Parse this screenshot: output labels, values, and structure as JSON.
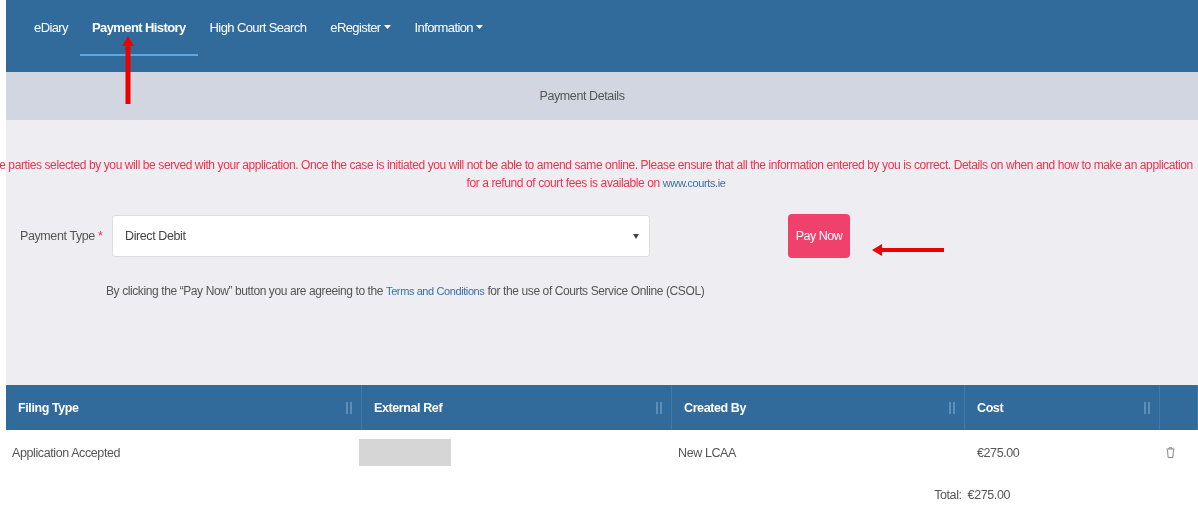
{
  "nav": {
    "items": [
      {
        "label": "eDiary",
        "selected": false,
        "dropdown": false
      },
      {
        "label": "Payment History",
        "selected": true,
        "dropdown": false
      },
      {
        "label": "High Court Search",
        "selected": false,
        "dropdown": false
      },
      {
        "label": "eRegister",
        "selected": false,
        "dropdown": true
      },
      {
        "label": "Information",
        "selected": false,
        "dropdown": true
      }
    ]
  },
  "subheader": {
    "title": "Payment Details"
  },
  "notice": {
    "line_1": "e parties selected by you will be served with your application. Once the case is initiated you will not be able to amend same online. Please ensure that all the information entered by you is correct. Details on when and how to make an application",
    "line_2": "for a refund of court fees is available on",
    "link": "www.courts.ie"
  },
  "payment_type": {
    "label": "Payment Type",
    "required_mark": "*",
    "value": "Direct Debit"
  },
  "pay_button": "Pay Now",
  "terms": {
    "before": "By clicking the “Pay Now” button you are agreeing to the",
    "link": "Terms and Conditions",
    "after": "for the use of Courts Service Online (CSOL)"
  },
  "table": {
    "columns": [
      "Filing Type",
      "External Ref",
      "Created By",
      "Cost"
    ],
    "rows": [
      {
        "filing_type": "Application Accepted",
        "created_by": "New LCAA",
        "cost": "€275.00"
      }
    ],
    "total_label": "Total:",
    "total_value": "€275.00"
  }
}
